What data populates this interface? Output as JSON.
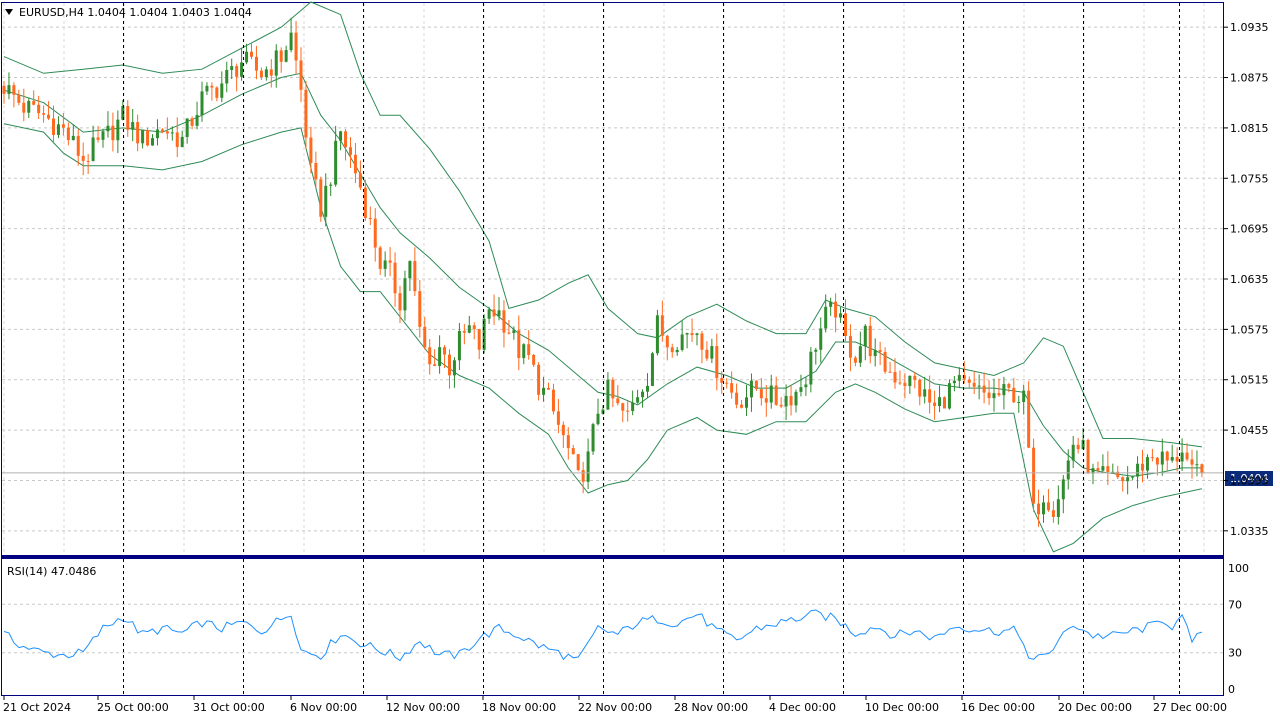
{
  "header": {
    "symbol_info": "EURUSD,H4  1.0404 1.0404 1.0403 1.0404",
    "menu_icon": "triangle-down-icon"
  },
  "price_panel": {
    "current_price_label": "1.0404",
    "price_labels": [
      "1.0935",
      "1.0875",
      "1.0815",
      "1.0755",
      "1.0695",
      "1.0635",
      "1.0575",
      "1.0515",
      "1.0455",
      "1.0395",
      "1.0335"
    ]
  },
  "rsi_panel": {
    "title": "RSI(14) 47.0486",
    "levels": [
      "100",
      "70",
      "30",
      "0"
    ]
  },
  "time_axis": {
    "labels": [
      "21 Oct 2024",
      "25 Oct 00:00",
      "31 Oct 00:00",
      "6 Nov 00:00",
      "12 Nov 00:00",
      "18 Nov 00:00",
      "22 Nov 00:00",
      "28 Nov 00:00",
      "4 Dec 00:00",
      "10 Dec 00:00",
      "16 Dec 00:00",
      "20 Dec 00:00",
      "27 Dec 00:00"
    ]
  },
  "colors": {
    "bull_candle": "#2e8b2e",
    "bear_candle": "#ff6a1f",
    "bands": "#2e8b57",
    "rsi_line": "#1e90ff",
    "price_tag_bg": "#0a2a7a",
    "grid": "#c8c8c8",
    "separator": "#000080"
  },
  "chart_data": [
    {
      "type": "candlestick",
      "title": "EURUSD,H4",
      "indicator": "Bollinger Bands",
      "ylim": [
        1.0305,
        1.0965
      ],
      "y_ticks": [
        1.0935,
        1.0875,
        1.0815,
        1.0755,
        1.0695,
        1.0635,
        1.0575,
        1.0515,
        1.0455,
        1.0395,
        1.0335
      ],
      "last": 1.0404,
      "close_path": [
        [
          0,
          1.0865
        ],
        [
          4,
          1.084
        ],
        [
          8,
          1.083
        ],
        [
          12,
          1.0812
        ],
        [
          16,
          1.0778
        ],
        [
          20,
          1.08
        ],
        [
          24,
          1.0828
        ],
        [
          28,
          1.08
        ],
        [
          32,
          1.0815
        ],
        [
          36,
          1.08
        ],
        [
          40,
          1.085
        ],
        [
          44,
          1.0868
        ],
        [
          48,
          1.0895
        ],
        [
          52,
          1.088
        ],
        [
          56,
          1.09
        ],
        [
          58,
          1.0925
        ],
        [
          60,
          1.086
        ],
        [
          62,
          1.076
        ],
        [
          64,
          1.072
        ],
        [
          66,
          1.076
        ],
        [
          68,
          1.081
        ],
        [
          70,
          1.078
        ],
        [
          72,
          1.0745
        ],
        [
          74,
          1.07
        ],
        [
          76,
          1.0655
        ],
        [
          78,
          1.064
        ],
        [
          80,
          1.061
        ],
        [
          82,
          1.066
        ],
        [
          84,
          1.057
        ],
        [
          86,
          1.053
        ],
        [
          88,
          1.0555
        ],
        [
          90,
          1.053
        ],
        [
          92,
          1.056
        ],
        [
          94,
          1.0575
        ],
        [
          96,
          1.0555
        ],
        [
          98,
          1.06
        ],
        [
          100,
          1.0595
        ],
        [
          102,
          1.0575
        ],
        [
          104,
          1.055
        ],
        [
          106,
          1.054
        ],
        [
          108,
          1.051
        ],
        [
          110,
          1.049
        ],
        [
          112,
          1.046
        ],
        [
          114,
          1.043
        ],
        [
          116,
          1.0395
        ],
        [
          118,
          1.042
        ],
        [
          120,
          1.048
        ],
        [
          122,
          1.05
        ],
        [
          124,
          1.048
        ],
        [
          126,
          1.047
        ],
        [
          128,
          1.05
        ],
        [
          130,
          1.052
        ],
        [
          132,
          1.058
        ],
        [
          134,
          1.056
        ],
        [
          136,
          1.0565
        ],
        [
          140,
          1.0575
        ],
        [
          144,
          1.053
        ],
        [
          148,
          1.049
        ],
        [
          152,
          1.0505
        ],
        [
          156,
          1.049
        ],
        [
          160,
          1.05
        ],
        [
          162,
          1.052
        ],
        [
          164,
          1.056
        ],
        [
          166,
          1.059
        ],
        [
          168,
          1.06
        ],
        [
          170,
          1.056
        ],
        [
          172,
          1.0545
        ],
        [
          174,
          1.057
        ],
        [
          176,
          1.054
        ],
        [
          180,
          1.052
        ],
        [
          184,
          1.051
        ],
        [
          188,
          1.048
        ],
        [
          192,
          1.051
        ],
        [
          196,
          1.05
        ],
        [
          200,
          1.0495
        ],
        [
          204,
          1.05
        ],
        [
          206,
          1.049
        ],
        [
          207,
          1.043
        ],
        [
          208,
          1.0355
        ],
        [
          210,
          1.038
        ],
        [
          212,
          1.0365
        ],
        [
          214,
          1.0395
        ],
        [
          216,
          1.044
        ],
        [
          218,
          1.043
        ],
        [
          220,
          1.04
        ],
        [
          224,
          1.0395
        ],
        [
          228,
          1.04
        ],
        [
          230,
          1.0415
        ],
        [
          232,
          1.0425
        ],
        [
          234,
          1.042
        ],
        [
          236,
          1.0415
        ],
        [
          238,
          1.0435
        ],
        [
          240,
          1.04
        ],
        [
          242,
          1.0404
        ]
      ],
      "bollinger_upper": [
        [
          0,
          1.09
        ],
        [
          8,
          1.088
        ],
        [
          16,
          1.0885
        ],
        [
          24,
          1.089
        ],
        [
          32,
          1.088
        ],
        [
          40,
          1.0885
        ],
        [
          48,
          1.091
        ],
        [
          56,
          1.0935
        ],
        [
          62,
          1.0965
        ],
        [
          68,
          1.095
        ],
        [
          72,
          1.088
        ],
        [
          76,
          1.083
        ],
        [
          80,
          1.083
        ],
        [
          86,
          1.079
        ],
        [
          92,
          1.074
        ],
        [
          98,
          1.068
        ],
        [
          102,
          1.06
        ],
        [
          108,
          1.061
        ],
        [
          114,
          1.063
        ],
        [
          118,
          1.064
        ],
        [
          122,
          1.06
        ],
        [
          128,
          1.057
        ],
        [
          132,
          1.0565
        ],
        [
          138,
          1.059
        ],
        [
          144,
          1.0605
        ],
        [
          150,
          1.0585
        ],
        [
          156,
          1.057
        ],
        [
          162,
          1.057
        ],
        [
          166,
          1.061
        ],
        [
          170,
          1.06
        ],
        [
          176,
          1.059
        ],
        [
          182,
          1.056
        ],
        [
          188,
          1.0535
        ],
        [
          192,
          1.053
        ],
        [
          196,
          1.0525
        ],
        [
          200,
          1.052
        ],
        [
          206,
          1.0535
        ],
        [
          210,
          1.0565
        ],
        [
          214,
          1.0555
        ],
        [
          218,
          1.05
        ],
        [
          222,
          1.0445
        ],
        [
          228,
          1.0445
        ],
        [
          236,
          1.044
        ],
        [
          242,
          1.0435
        ]
      ],
      "bollinger_middle": [
        [
          0,
          1.086
        ],
        [
          8,
          1.0845
        ],
        [
          16,
          1.081
        ],
        [
          24,
          1.0815
        ],
        [
          32,
          1.081
        ],
        [
          40,
          1.083
        ],
        [
          48,
          1.0855
        ],
        [
          56,
          1.0875
        ],
        [
          60,
          1.088
        ],
        [
          64,
          1.083
        ],
        [
          68,
          1.08
        ],
        [
          72,
          1.076
        ],
        [
          76,
          1.072
        ],
        [
          80,
          1.069
        ],
        [
          86,
          1.066
        ],
        [
          92,
          1.0625
        ],
        [
          98,
          1.06
        ],
        [
          104,
          1.057
        ],
        [
          110,
          1.055
        ],
        [
          116,
          1.052
        ],
        [
          120,
          1.05
        ],
        [
          124,
          1.0495
        ],
        [
          128,
          1.0485
        ],
        [
          134,
          1.051
        ],
        [
          140,
          1.053
        ],
        [
          146,
          1.052
        ],
        [
          152,
          1.0505
        ],
        [
          158,
          1.0505
        ],
        [
          164,
          1.0525
        ],
        [
          168,
          1.056
        ],
        [
          172,
          1.056
        ],
        [
          176,
          1.055
        ],
        [
          182,
          1.053
        ],
        [
          188,
          1.051
        ],
        [
          194,
          1.0505
        ],
        [
          200,
          1.0505
        ],
        [
          206,
          1.05
        ],
        [
          210,
          1.046
        ],
        [
          214,
          1.043
        ],
        [
          218,
          1.041
        ],
        [
          222,
          1.0405
        ],
        [
          228,
          1.04
        ],
        [
          234,
          1.0405
        ],
        [
          238,
          1.041
        ],
        [
          242,
          1.041
        ]
      ],
      "bollinger_lower": [
        [
          0,
          1.082
        ],
        [
          8,
          1.081
        ],
        [
          12,
          1.0785
        ],
        [
          16,
          1.077
        ],
        [
          24,
          1.077
        ],
        [
          32,
          1.0765
        ],
        [
          40,
          1.0775
        ],
        [
          48,
          1.0795
        ],
        [
          56,
          1.081
        ],
        [
          60,
          1.0815
        ],
        [
          64,
          1.072
        ],
        [
          68,
          1.065
        ],
        [
          72,
          1.062
        ],
        [
          76,
          1.062
        ],
        [
          80,
          1.059
        ],
        [
          86,
          1.0545
        ],
        [
          92,
          1.052
        ],
        [
          98,
          1.0505
        ],
        [
          104,
          1.0475
        ],
        [
          110,
          1.045
        ],
        [
          114,
          1.041
        ],
        [
          118,
          1.038
        ],
        [
          122,
          1.039
        ],
        [
          126,
          1.0395
        ],
        [
          130,
          1.042
        ],
        [
          134,
          1.0455
        ],
        [
          140,
          1.047
        ],
        [
          144,
          1.0455
        ],
        [
          150,
          1.045
        ],
        [
          156,
          1.0465
        ],
        [
          162,
          1.0465
        ],
        [
          168,
          1.05
        ],
        [
          172,
          1.051
        ],
        [
          176,
          1.05
        ],
        [
          182,
          1.048
        ],
        [
          188,
          1.0465
        ],
        [
          194,
          1.047
        ],
        [
          200,
          1.0475
        ],
        [
          204,
          1.0475
        ],
        [
          208,
          1.036
        ],
        [
          212,
          1.031
        ],
        [
          216,
          1.032
        ],
        [
          222,
          1.035
        ],
        [
          228,
          1.0365
        ],
        [
          234,
          1.0375
        ],
        [
          242,
          1.0385
        ]
      ]
    },
    {
      "type": "line",
      "title": "RSI(14) 47.0486",
      "ylim": [
        0,
        100
      ],
      "levels": [
        70,
        30
      ],
      "last": 47.0486,
      "path": [
        [
          0,
          45
        ],
        [
          4,
          35
        ],
        [
          8,
          30
        ],
        [
          12,
          28
        ],
        [
          16,
          30
        ],
        [
          20,
          50
        ],
        [
          24,
          60
        ],
        [
          28,
          45
        ],
        [
          32,
          50
        ],
        [
          36,
          46
        ],
        [
          40,
          55
        ],
        [
          44,
          50
        ],
        [
          48,
          55
        ],
        [
          52,
          48
        ],
        [
          56,
          58
        ],
        [
          58,
          64
        ],
        [
          60,
          32
        ],
        [
          64,
          28
        ],
        [
          68,
          46
        ],
        [
          72,
          38
        ],
        [
          76,
          32
        ],
        [
          80,
          26
        ],
        [
          84,
          40
        ],
        [
          88,
          28
        ],
        [
          92,
          28
        ],
        [
          96,
          42
        ],
        [
          100,
          50
        ],
        [
          104,
          44
        ],
        [
          108,
          36
        ],
        [
          112,
          30
        ],
        [
          116,
          23
        ],
        [
          120,
          50
        ],
        [
          124,
          45
        ],
        [
          128,
          55
        ],
        [
          132,
          58
        ],
        [
          136,
          54
        ],
        [
          140,
          62
        ],
        [
          144,
          48
        ],
        [
          148,
          40
        ],
        [
          152,
          50
        ],
        [
          156,
          54
        ],
        [
          160,
          58
        ],
        [
          164,
          62
        ],
        [
          168,
          58
        ],
        [
          172,
          46
        ],
        [
          176,
          52
        ],
        [
          180,
          44
        ],
        [
          184,
          48
        ],
        [
          188,
          42
        ],
        [
          192,
          52
        ],
        [
          196,
          50
        ],
        [
          200,
          48
        ],
        [
          204,
          48
        ],
        [
          206,
          40
        ],
        [
          207,
          25
        ],
        [
          208,
          22
        ],
        [
          212,
          34
        ],
        [
          216,
          54
        ],
        [
          220,
          44
        ],
        [
          224,
          44
        ],
        [
          228,
          48
        ],
        [
          232,
          52
        ],
        [
          234,
          58
        ],
        [
          236,
          52
        ],
        [
          238,
          58
        ],
        [
          240,
          40
        ],
        [
          242,
          47
        ]
      ]
    }
  ]
}
